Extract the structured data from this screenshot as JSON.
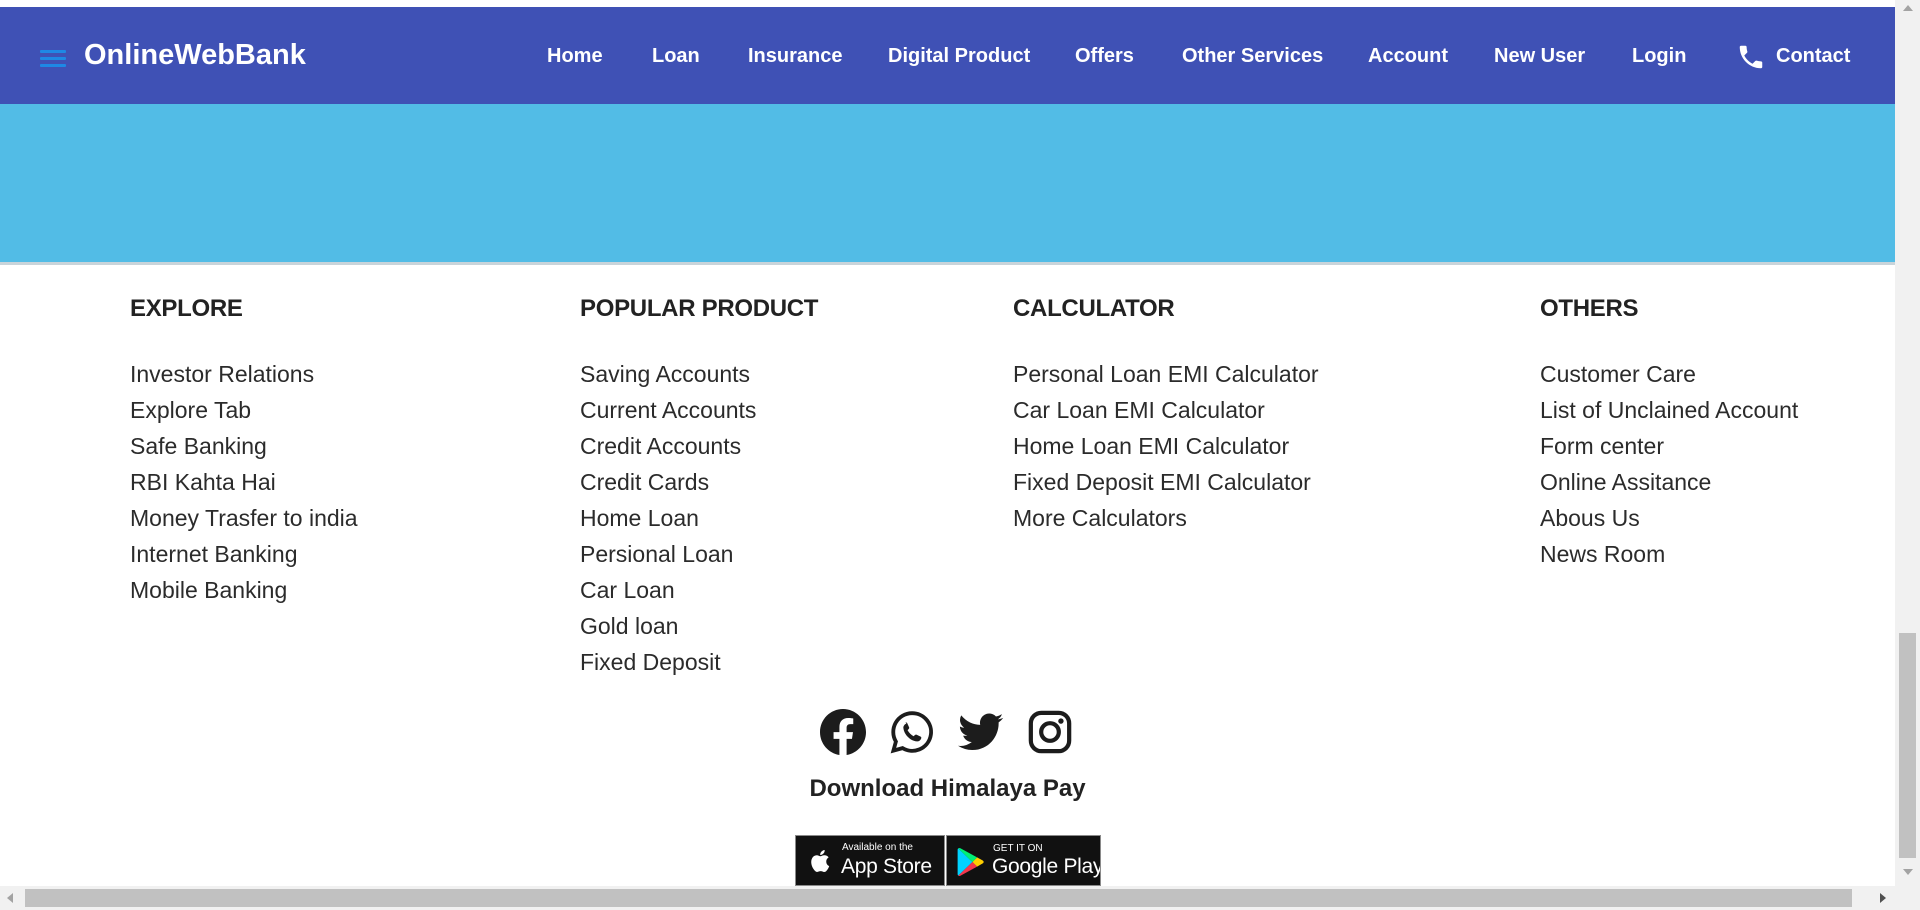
{
  "navbar": {
    "brand": "OnlineWebBank",
    "links": [
      {
        "label": "Home"
      },
      {
        "label": "Loan"
      },
      {
        "label": "Insurance"
      },
      {
        "label": "Digital Product"
      },
      {
        "label": "Offers"
      },
      {
        "label": "Other Services"
      },
      {
        "label": "Account"
      },
      {
        "label": "New User"
      },
      {
        "label": "Login"
      },
      {
        "label": "Contact",
        "icon": "phone-icon"
      }
    ],
    "colors": {
      "background": "#3f51b5",
      "menu_icon": "#1e88e5",
      "banner": "#52bce6"
    }
  },
  "footer": {
    "columns": [
      {
        "title": "EXPLORE",
        "items": [
          "Investor Relations",
          "Explore Tab",
          "Safe Banking",
          "RBI Kahta Hai",
          "Money Trasfer to india",
          "Internet Banking",
          "Mobile Banking"
        ]
      },
      {
        "title": "POPULAR PRODUCT",
        "items": [
          "Saving Accounts",
          "Current Accounts",
          "Credit Accounts",
          "Credit Cards",
          "Home Loan",
          "Persional Loan",
          "Car Loan",
          "Gold loan",
          "Fixed Deposit"
        ]
      },
      {
        "title": "CALCULATOR",
        "items": [
          "Personal Loan EMI Calculator",
          "Car Loan EMI Calculator",
          "Home Loan EMI Calculator",
          "Fixed Deposit EMI Calculator",
          "More Calculators"
        ]
      },
      {
        "title": "OTHERS",
        "items": [
          "Customer Care",
          "List of Unclained Account",
          "Form center",
          "Online Assitance",
          "Abous Us",
          "News Room"
        ]
      }
    ],
    "social": [
      "facebook-icon",
      "whatsapp-icon",
      "twitter-icon",
      "instagram-icon"
    ],
    "download_title": "Download Himalaya Pay",
    "badges": {
      "apple": {
        "small": "Available on the",
        "big": "App Store"
      },
      "google": {
        "small": "GET IT ON",
        "big": "Google Play"
      }
    }
  }
}
